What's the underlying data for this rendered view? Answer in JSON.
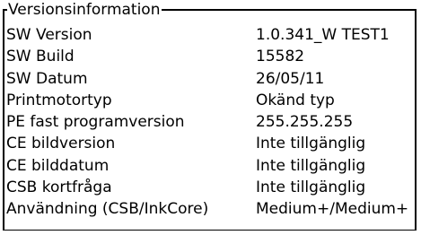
{
  "panel": {
    "title": "Versionsinformation"
  },
  "rows": [
    {
      "label": "SW Version",
      "value": "1.0.341_W TEST1"
    },
    {
      "label": "SW Build",
      "value": "15582"
    },
    {
      "label": "SW Datum",
      "value": "26/05/11"
    },
    {
      "label": "Printmotortyp",
      "value": "Okänd typ"
    },
    {
      "label": "PE fast programversion",
      "value": "255.255.255"
    },
    {
      "label": "CE bildversion",
      "value": "Inte tillgänglig"
    },
    {
      "label": "CE bilddatum",
      "value": "Inte tillgänglig"
    },
    {
      "label": "CSB kortfråga",
      "value": "Inte tillgänglig"
    },
    {
      "label": "Användning (CSB/InkCore)",
      "value": "Medium+/Medium+"
    }
  ]
}
